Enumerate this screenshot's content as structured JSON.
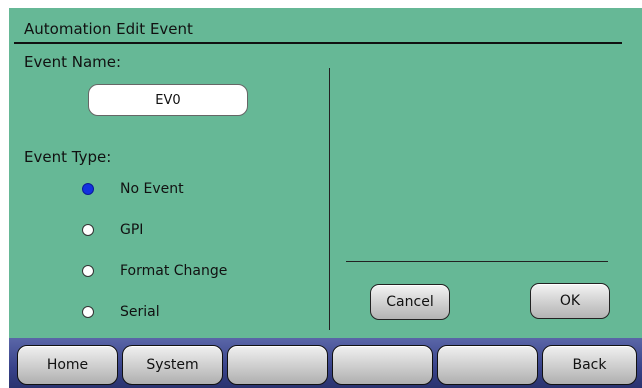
{
  "header": {
    "title": "Automation Edit Event"
  },
  "event_name": {
    "label": "Event Name:",
    "value": "EV0"
  },
  "event_type": {
    "label": "Event Type:",
    "selected": "No Event",
    "options": [
      "No Event",
      "GPI",
      "Format Change",
      "Serial"
    ]
  },
  "dialog": {
    "cancel_label": "Cancel",
    "ok_label": "OK"
  },
  "nav": {
    "buttons": [
      "Home",
      "System",
      "",
      "",
      "",
      "Back"
    ]
  },
  "colors": {
    "panel_bg": "#66b896",
    "nav_bg": "#38428a",
    "radio_selected": "#1230e0"
  }
}
